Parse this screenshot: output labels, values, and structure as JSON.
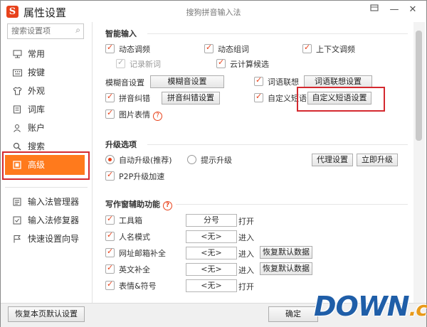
{
  "window": {
    "app_title": "属性设置",
    "title": "搜狗拼音输入法",
    "logo_letter": "S"
  },
  "sidebar": {
    "search_placeholder": "搜索设置项",
    "items": [
      {
        "label": "常用",
        "icon": "monitor-icon"
      },
      {
        "label": "按键",
        "icon": "keyboard-icon"
      },
      {
        "label": "外观",
        "icon": "shirt-icon"
      },
      {
        "label": "词库",
        "icon": "book-icon"
      },
      {
        "label": "账户",
        "icon": "user-icon"
      },
      {
        "label": "搜索",
        "icon": "search-icon"
      },
      {
        "label": "高级",
        "icon": "advanced-icon",
        "active": true
      }
    ],
    "tools": [
      {
        "label": "输入法管理器"
      },
      {
        "label": "输入法修复器"
      },
      {
        "label": "快速设置向导"
      }
    ]
  },
  "smart_input": {
    "title": "智能输入",
    "dynamic_freq": "动态调频",
    "dynamic_combine": "动态组词",
    "context_freq": "上下文调频",
    "record_new": "记录新词",
    "cloud_candidate": "云计算候选",
    "fuzzy_label": "模糊音设置",
    "fuzzy_btn": "模糊音设置",
    "word_assoc": "词语联想",
    "word_assoc_btn": "词语联想设置",
    "pinyin_correct": "拼音纠错",
    "pinyin_correct_btn": "拼音纠错设置",
    "custom_phrase": "自定义短语",
    "custom_phrase_btn": "自定义短语设置",
    "image_emoji": "图片表情"
  },
  "upgrade": {
    "title": "升级选项",
    "auto_upgrade": "自动升级(推荐)",
    "prompt_upgrade": "提示升级",
    "proxy_btn": "代理设置",
    "upgrade_now_btn": "立即升级",
    "p2p": "P2P升级加速"
  },
  "writing": {
    "title": "写作窗辅助功能",
    "rows": [
      {
        "label": "工具箱",
        "value": "分号",
        "action": "打开",
        "btn": ""
      },
      {
        "label": "人名模式",
        "value": "<无>",
        "action": "进入",
        "btn": ""
      },
      {
        "label": "网址邮箱补全",
        "value": "<无>",
        "action": "进入",
        "btn": "恢复默认数据"
      },
      {
        "label": "英文补全",
        "value": "<无>",
        "action": "进入",
        "btn": "恢复默认数据"
      },
      {
        "label": "表情&符号",
        "value": "<无>",
        "action": "打开",
        "btn": ""
      }
    ]
  },
  "footer": {
    "restore_btn": "恢复本页默认设置",
    "ok_btn": "确定"
  },
  "watermark": {
    "main": "DOWN",
    "suffix": ".cc"
  },
  "colors": {
    "accent": "#ff7a1c",
    "highlight": "#d4292f",
    "brand": "#e8421b"
  }
}
